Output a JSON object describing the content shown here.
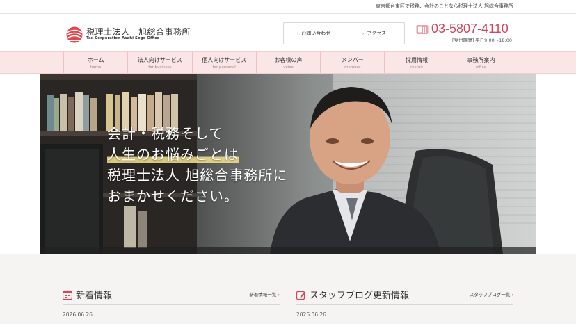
{
  "header": {
    "tagline": "東京都台東区で税務、会計のことなら税理士法人 旭総合事務所",
    "logo_name": "税理士法人　旭総合事務所",
    "logo_en_line1": "Tax Corporation Asahi Sogo Office",
    "contact_label": "お問い合わせ",
    "access_label": "アクセス",
    "phone": "03-5807-4110",
    "hours": "[受付時間] 平日9:00～18:00",
    "accent_color": "#d0485b"
  },
  "nav": {
    "items": [
      {
        "ja": "ホーム",
        "en": "home"
      },
      {
        "ja": "法人向けサービス",
        "en": "for business"
      },
      {
        "ja": "個人向けサービス",
        "en": "for personal"
      },
      {
        "ja": "お客様の声",
        "en": "voice"
      },
      {
        "ja": "メンバー",
        "en": "member"
      },
      {
        "ja": "採用情報",
        "en": "recruit"
      },
      {
        "ja": "事務所案内",
        "en": "office"
      }
    ]
  },
  "hero": {
    "lines": [
      "会計・税務そして",
      "人生のお悩みごとは",
      "税理士法人 旭総合事務所に",
      "おまかせください。"
    ]
  },
  "news": {
    "title": "新着情報",
    "link": "新着情報一覧",
    "date": "2026.06.26"
  },
  "blog": {
    "title": "スタッフブログ更新情報",
    "link": "スタッフブログ一覧",
    "date": "2026.06.26"
  },
  "icons": {
    "logo": "sunrise-logo-icon",
    "contact": "chevron-right-icon",
    "phone": "phone-icon",
    "news": "calendar-icon",
    "blog": "pencil-icon"
  }
}
